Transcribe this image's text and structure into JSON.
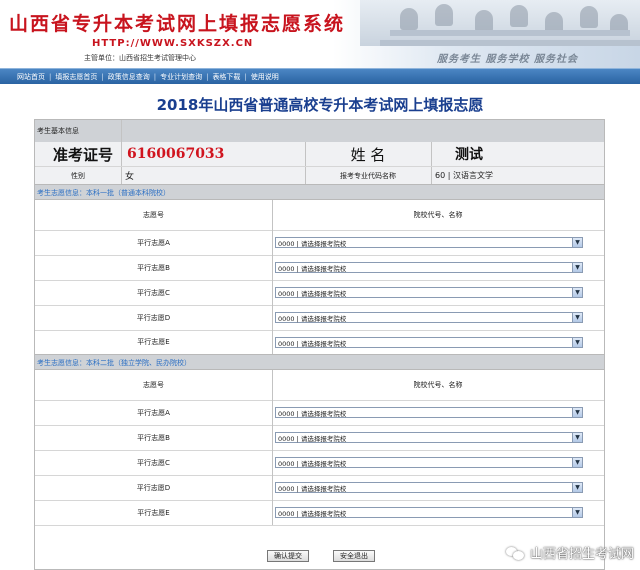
{
  "header": {
    "site_title": "山西省专升本考试网上填报志愿系统",
    "url": "HTTP://WWW.SXKSZX.CN",
    "host": "主管单位：山西省招生考试管理中心",
    "slogan": "服务考生  服务学校  服务社会"
  },
  "nav": [
    "网站首页",
    "填报志愿首页",
    "政策信息查询",
    "专业计划查询",
    "表格下载",
    "使用说明"
  ],
  "page_title": "2018年山西省普通高校专升本考试网上填报志愿",
  "student": {
    "section_label": "考生基本信息",
    "exam_no_label": "准考证号",
    "exam_no": "6160067033",
    "name_label": "姓  名",
    "name": "测试",
    "gender_label": "性别",
    "gender": "女",
    "major_label": "报考专业代码名称",
    "major": "60 | 汉语言文学"
  },
  "batch1": {
    "title": "考生志愿信息：本科一批（普通本科院校）",
    "col_choice": "志愿号",
    "col_school": "院校代号、名称",
    "rows": [
      {
        "label": "平行志愿A",
        "value": "0000 | 请选择报考院校"
      },
      {
        "label": "平行志愿B",
        "value": "0000 | 请选择报考院校"
      },
      {
        "label": "平行志愿C",
        "value": "0000 | 请选择报考院校"
      },
      {
        "label": "平行志愿D",
        "value": "0000 | 请选择报考院校"
      },
      {
        "label": "平行志愿E",
        "value": "0000 | 请选择报考院校"
      }
    ]
  },
  "batch2": {
    "title": "考生志愿信息：本科二批（独立学院、民办院校）",
    "col_choice": "志愿号",
    "col_school": "院校代号、名称",
    "rows": [
      {
        "label": "平行志愿A",
        "value": "0000 | 请选择报考院校"
      },
      {
        "label": "平行志愿B",
        "value": "0000 | 请选择报考院校"
      },
      {
        "label": "平行志愿C",
        "value": "0000 | 请选择报考院校"
      },
      {
        "label": "平行志愿D",
        "value": "0000 | 请选择报考院校"
      },
      {
        "label": "平行志愿E",
        "value": "0000 | 请选择报考院校"
      }
    ]
  },
  "buttons": {
    "submit": "确认提交",
    "exit": "安全退出"
  },
  "watermark": "山西省招生考试网",
  "icons": {
    "select_arrow": "chevron-down-icon",
    "watermark": "wechat-icon"
  }
}
